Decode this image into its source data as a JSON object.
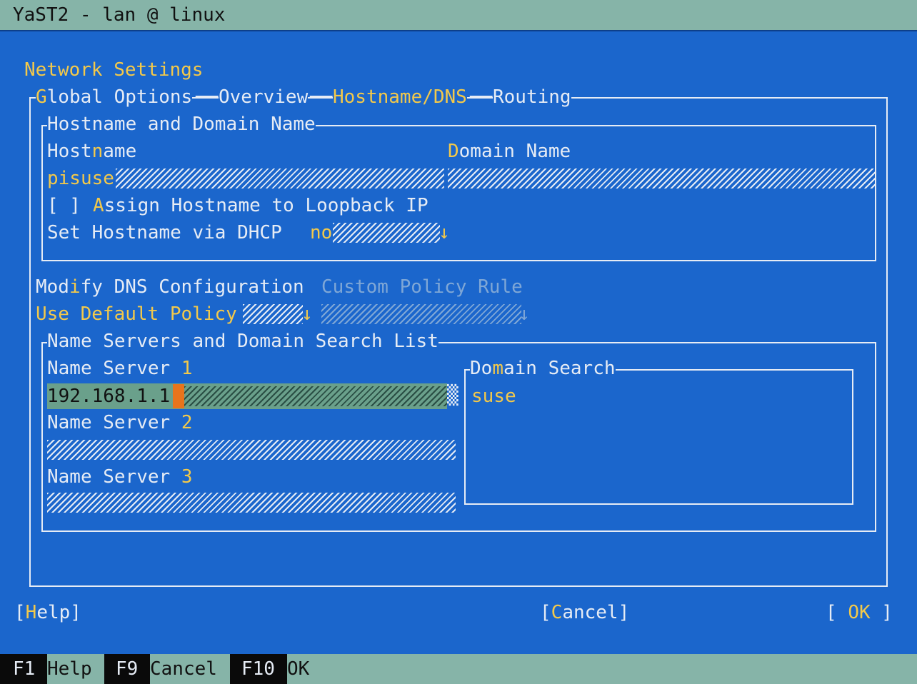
{
  "window": {
    "title": "YaST2 - lan @ linux"
  },
  "dialog": {
    "heading": "Network Settings"
  },
  "tabs": [
    {
      "label": "Global Options",
      "hotkey": "l"
    },
    {
      "label": "Overview"
    },
    {
      "label": "Hostname/DNS",
      "active": true
    },
    {
      "label": "Routing"
    }
  ],
  "hostname_section": {
    "title": "Hostname and Domain Name",
    "hostname_label": "Hostname",
    "hostname_value": "pisuse",
    "domain_label": "Domain Name",
    "domain_value": "",
    "loopback_checkbox": "[ ]",
    "loopback_label": "Assign Hostname to Loopback IP",
    "dhcp_label": "Set Hostname via DHCP",
    "dhcp_value": "no",
    "dhcp_arrow": "↓"
  },
  "dns": {
    "modify_label": "Modify DNS Configuration",
    "policy_label": "Custom Policy Rule",
    "modify_value": "Use Default Policy",
    "modify_arrow": "↓",
    "policy_arrow": "↓"
  },
  "nameservers_section": {
    "title": "Name Servers and Domain Search List",
    "ns1_label": "Name Server ",
    "ns1_num": "1",
    "ns1_value": "192.168.1.1",
    "ns2_label": "Name Server ",
    "ns2_num": "2",
    "ns2_value": "",
    "ns3_label": "Name Server ",
    "ns3_num": "3",
    "ns3_value": "",
    "domain_search_title": "Domain Search",
    "domain_search_value": "suse"
  },
  "buttons": {
    "help": "[Help]",
    "cancel": "[Cancel]",
    "ok_left": "[ ",
    "ok": "OK",
    "ok_right": " ]"
  },
  "fkeys": [
    {
      "key": "F1",
      "label": "Help"
    },
    {
      "key": "F9",
      "label": "Cancel"
    },
    {
      "key": "F10",
      "label": "OK"
    }
  ],
  "colors": {
    "background": "#1b66cc",
    "highlight": "#f3c94a",
    "bar": "#86b4a8",
    "cursor": "#e8741c"
  }
}
